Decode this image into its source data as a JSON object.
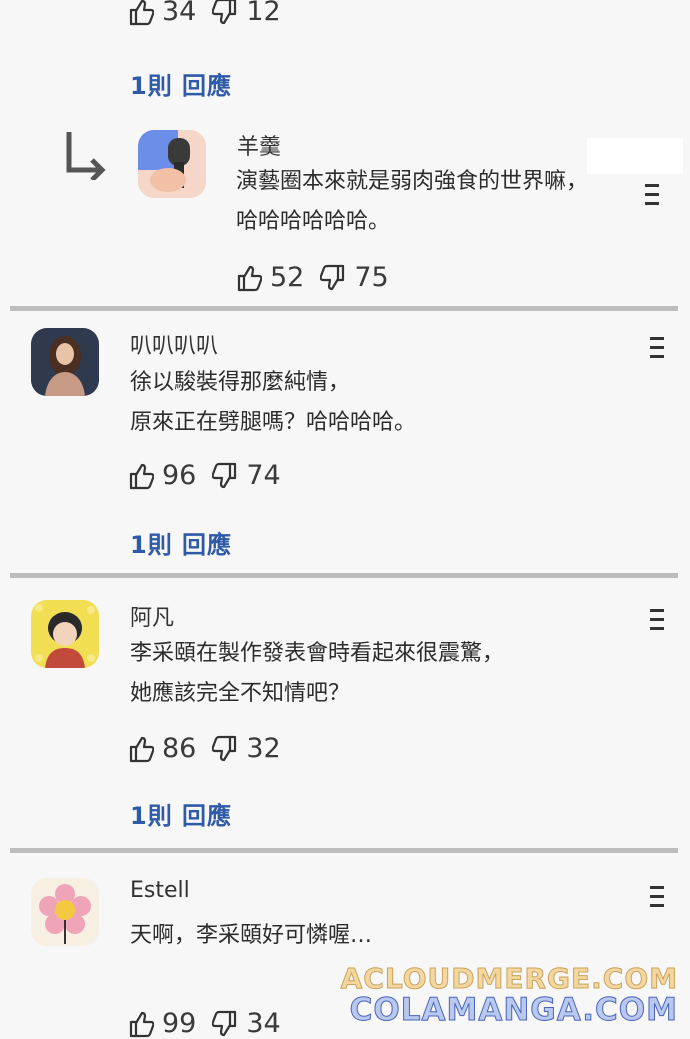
{
  "top_votes": {
    "likes": "34",
    "dislikes": "12"
  },
  "top_reply_link": "1則 回應",
  "reply": {
    "name": "羊羹",
    "text": "演藝圈本來就是弱肉強食的世界嘛，\n哈哈哈哈哈哈。",
    "likes": "52",
    "dislikes": "75"
  },
  "comments": [
    {
      "name": "叭叭叭叭",
      "text": "徐以駿裝得那麼純情，\n原來正在劈腿嗎？哈哈哈哈。",
      "likes": "96",
      "dislikes": "74",
      "reply_link": "1則 回應"
    },
    {
      "name": "阿凡",
      "text": "李采頤在製作發表會時看起來很震驚，\n她應該完全不知情吧？",
      "likes": "86",
      "dislikes": "32",
      "reply_link": "1則 回應"
    },
    {
      "name": "Estell",
      "text": "天啊，李采頤好可憐喔…",
      "likes": "99",
      "dislikes": "34"
    }
  ],
  "watermark": {
    "line1": "ACLOUDMERGE.COM",
    "line2": "COLAMANGA.COM"
  }
}
